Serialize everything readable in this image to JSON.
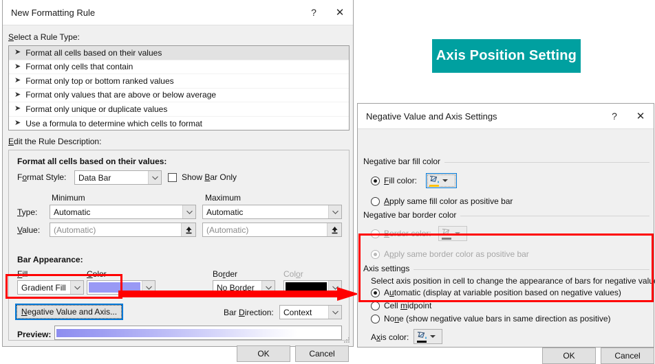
{
  "banner": {
    "text": "Axis Position Setting",
    "bg_color": "#00a0a0",
    "text_color": "#ffffff"
  },
  "annotation": {
    "box_color": "#ff0000",
    "arrow_color": "#ff0000"
  },
  "new_formatting_rule_dialog": {
    "title": "New Formatting Rule",
    "help_icon": "?",
    "close_icon": "✕",
    "select_rule_type_label": "Select a Rule Type:",
    "rule_types": [
      {
        "label": "Format all cells based on their values",
        "selected": true
      },
      {
        "label": "Format only cells that contain",
        "selected": false
      },
      {
        "label": "Format only top or bottom ranked values",
        "selected": false
      },
      {
        "label": "Format only values that are above or below average",
        "selected": false
      },
      {
        "label": "Format only unique or duplicate values",
        "selected": false
      },
      {
        "label": "Use a formula to determine which cells to format",
        "selected": false
      }
    ],
    "edit_rule_description_label": "Edit the Rule Description:",
    "rule_description_heading": "Format all cells based on their values:",
    "format_style_label": "Format Style:",
    "format_style_value": "Data Bar",
    "show_bar_only_label": "Show Bar Only",
    "show_bar_only_checked": false,
    "minimum_header": "Minimum",
    "maximum_header": "Maximum",
    "type_label": "Type:",
    "type_minimum_value": "Automatic",
    "type_maximum_value": "Automatic",
    "value_label": "Value:",
    "value_minimum_placeholder": "(Automatic)",
    "value_maximum_placeholder": "(Automatic)",
    "bar_appearance_heading": "Bar Appearance:",
    "fill_label": "Fill",
    "fill_value": "Gradient Fill",
    "fill_color_label": "Color",
    "fill_color_value": "#9999f5",
    "border_label": "Border",
    "border_value": "No Border",
    "border_color_label": "Color",
    "border_color_value": "#000000",
    "negative_value_button": "Negative Value and Axis...",
    "bar_direction_label": "Bar Direction:",
    "bar_direction_value": "Context",
    "preview_label": "Preview:",
    "ok_label": "OK",
    "cancel_label": "Cancel"
  },
  "negative_value_axis_dialog": {
    "title": "Negative Value and Axis Settings",
    "help_icon": "?",
    "close_icon": "✕",
    "negative_bar_fill_color_group": "Negative bar fill color",
    "fill_color_radio_label": "Fill color:",
    "fill_color_radio_selected": true,
    "fill_color_swatch": "#ffc000",
    "apply_same_fill_label": "Apply same fill color as positive bar",
    "apply_same_fill_selected": false,
    "negative_bar_border_color_group": "Negative bar border color",
    "border_color_radio_label": "Border color:",
    "border_color_radio_selected": false,
    "border_color_radio_disabled": true,
    "border_color_swatch": "#7f7f7f",
    "apply_same_border_label": "Apply same border color as positive bar",
    "apply_same_border_selected": true,
    "apply_same_border_disabled": true,
    "axis_settings_group": "Axis settings",
    "axis_settings_hint": "Select axis position in cell to change the appearance of bars for negative values",
    "axis_options": [
      {
        "label": "Automatic (display at variable position based on negative values)",
        "selected": true
      },
      {
        "label": "Cell midpoint",
        "selected": false
      },
      {
        "label": "None (show negative value bars in same direction as positive)",
        "selected": false
      }
    ],
    "axis_color_label": "Axis color:",
    "axis_color_swatch": "#000000",
    "ok_label": "OK",
    "cancel_label": "Cancel"
  }
}
